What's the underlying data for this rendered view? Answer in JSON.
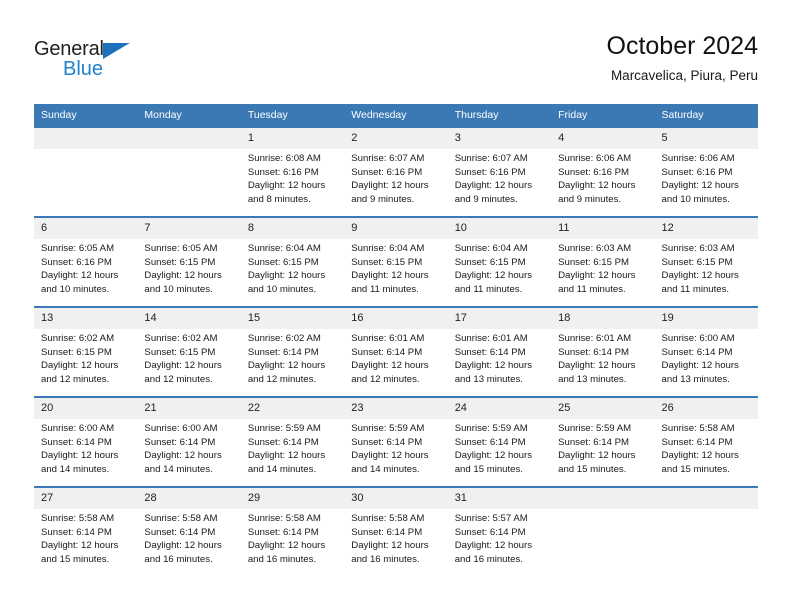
{
  "logo": {
    "word_one": "General",
    "word_two": "Blue",
    "triangle_color": "#1e72bb",
    "blue_color": "#2081cc"
  },
  "header": {
    "title": "October 2024",
    "subtitle": "Marcavelica, Piura, Peru"
  },
  "theme": {
    "header_blue": "#3b79b5",
    "daynum_bg": "#f0f0f0",
    "text": "#1a1a1a"
  },
  "weekdays": [
    "Sunday",
    "Monday",
    "Tuesday",
    "Wednesday",
    "Thursday",
    "Friday",
    "Saturday"
  ],
  "weeks": [
    [
      {
        "day": "",
        "sunrise": "",
        "sunset": "",
        "daylight": ""
      },
      {
        "day": "",
        "sunrise": "",
        "sunset": "",
        "daylight": ""
      },
      {
        "day": "1",
        "sunrise": "Sunrise: 6:08 AM",
        "sunset": "Sunset: 6:16 PM",
        "daylight": "Daylight: 12 hours and 8 minutes."
      },
      {
        "day": "2",
        "sunrise": "Sunrise: 6:07 AM",
        "sunset": "Sunset: 6:16 PM",
        "daylight": "Daylight: 12 hours and 9 minutes."
      },
      {
        "day": "3",
        "sunrise": "Sunrise: 6:07 AM",
        "sunset": "Sunset: 6:16 PM",
        "daylight": "Daylight: 12 hours and 9 minutes."
      },
      {
        "day": "4",
        "sunrise": "Sunrise: 6:06 AM",
        "sunset": "Sunset: 6:16 PM",
        "daylight": "Daylight: 12 hours and 9 minutes."
      },
      {
        "day": "5",
        "sunrise": "Sunrise: 6:06 AM",
        "sunset": "Sunset: 6:16 PM",
        "daylight": "Daylight: 12 hours and 10 minutes."
      }
    ],
    [
      {
        "day": "6",
        "sunrise": "Sunrise: 6:05 AM",
        "sunset": "Sunset: 6:16 PM",
        "daylight": "Daylight: 12 hours and 10 minutes."
      },
      {
        "day": "7",
        "sunrise": "Sunrise: 6:05 AM",
        "sunset": "Sunset: 6:15 PM",
        "daylight": "Daylight: 12 hours and 10 minutes."
      },
      {
        "day": "8",
        "sunrise": "Sunrise: 6:04 AM",
        "sunset": "Sunset: 6:15 PM",
        "daylight": "Daylight: 12 hours and 10 minutes."
      },
      {
        "day": "9",
        "sunrise": "Sunrise: 6:04 AM",
        "sunset": "Sunset: 6:15 PM",
        "daylight": "Daylight: 12 hours and 11 minutes."
      },
      {
        "day": "10",
        "sunrise": "Sunrise: 6:04 AM",
        "sunset": "Sunset: 6:15 PM",
        "daylight": "Daylight: 12 hours and 11 minutes."
      },
      {
        "day": "11",
        "sunrise": "Sunrise: 6:03 AM",
        "sunset": "Sunset: 6:15 PM",
        "daylight": "Daylight: 12 hours and 11 minutes."
      },
      {
        "day": "12",
        "sunrise": "Sunrise: 6:03 AM",
        "sunset": "Sunset: 6:15 PM",
        "daylight": "Daylight: 12 hours and 11 minutes."
      }
    ],
    [
      {
        "day": "13",
        "sunrise": "Sunrise: 6:02 AM",
        "sunset": "Sunset: 6:15 PM",
        "daylight": "Daylight: 12 hours and 12 minutes."
      },
      {
        "day": "14",
        "sunrise": "Sunrise: 6:02 AM",
        "sunset": "Sunset: 6:15 PM",
        "daylight": "Daylight: 12 hours and 12 minutes."
      },
      {
        "day": "15",
        "sunrise": "Sunrise: 6:02 AM",
        "sunset": "Sunset: 6:14 PM",
        "daylight": "Daylight: 12 hours and 12 minutes."
      },
      {
        "day": "16",
        "sunrise": "Sunrise: 6:01 AM",
        "sunset": "Sunset: 6:14 PM",
        "daylight": "Daylight: 12 hours and 12 minutes."
      },
      {
        "day": "17",
        "sunrise": "Sunrise: 6:01 AM",
        "sunset": "Sunset: 6:14 PM",
        "daylight": "Daylight: 12 hours and 13 minutes."
      },
      {
        "day": "18",
        "sunrise": "Sunrise: 6:01 AM",
        "sunset": "Sunset: 6:14 PM",
        "daylight": "Daylight: 12 hours and 13 minutes."
      },
      {
        "day": "19",
        "sunrise": "Sunrise: 6:00 AM",
        "sunset": "Sunset: 6:14 PM",
        "daylight": "Daylight: 12 hours and 13 minutes."
      }
    ],
    [
      {
        "day": "20",
        "sunrise": "Sunrise: 6:00 AM",
        "sunset": "Sunset: 6:14 PM",
        "daylight": "Daylight: 12 hours and 14 minutes."
      },
      {
        "day": "21",
        "sunrise": "Sunrise: 6:00 AM",
        "sunset": "Sunset: 6:14 PM",
        "daylight": "Daylight: 12 hours and 14 minutes."
      },
      {
        "day": "22",
        "sunrise": "Sunrise: 5:59 AM",
        "sunset": "Sunset: 6:14 PM",
        "daylight": "Daylight: 12 hours and 14 minutes."
      },
      {
        "day": "23",
        "sunrise": "Sunrise: 5:59 AM",
        "sunset": "Sunset: 6:14 PM",
        "daylight": "Daylight: 12 hours and 14 minutes."
      },
      {
        "day": "24",
        "sunrise": "Sunrise: 5:59 AM",
        "sunset": "Sunset: 6:14 PM",
        "daylight": "Daylight: 12 hours and 15 minutes."
      },
      {
        "day": "25",
        "sunrise": "Sunrise: 5:59 AM",
        "sunset": "Sunset: 6:14 PM",
        "daylight": "Daylight: 12 hours and 15 minutes."
      },
      {
        "day": "26",
        "sunrise": "Sunrise: 5:58 AM",
        "sunset": "Sunset: 6:14 PM",
        "daylight": "Daylight: 12 hours and 15 minutes."
      }
    ],
    [
      {
        "day": "27",
        "sunrise": "Sunrise: 5:58 AM",
        "sunset": "Sunset: 6:14 PM",
        "daylight": "Daylight: 12 hours and 15 minutes."
      },
      {
        "day": "28",
        "sunrise": "Sunrise: 5:58 AM",
        "sunset": "Sunset: 6:14 PM",
        "daylight": "Daylight: 12 hours and 16 minutes."
      },
      {
        "day": "29",
        "sunrise": "Sunrise: 5:58 AM",
        "sunset": "Sunset: 6:14 PM",
        "daylight": "Daylight: 12 hours and 16 minutes."
      },
      {
        "day": "30",
        "sunrise": "Sunrise: 5:58 AM",
        "sunset": "Sunset: 6:14 PM",
        "daylight": "Daylight: 12 hours and 16 minutes."
      },
      {
        "day": "31",
        "sunrise": "Sunrise: 5:57 AM",
        "sunset": "Sunset: 6:14 PM",
        "daylight": "Daylight: 12 hours and 16 minutes."
      },
      {
        "day": "",
        "sunrise": "",
        "sunset": "",
        "daylight": ""
      },
      {
        "day": "",
        "sunrise": "",
        "sunset": "",
        "daylight": ""
      }
    ]
  ]
}
